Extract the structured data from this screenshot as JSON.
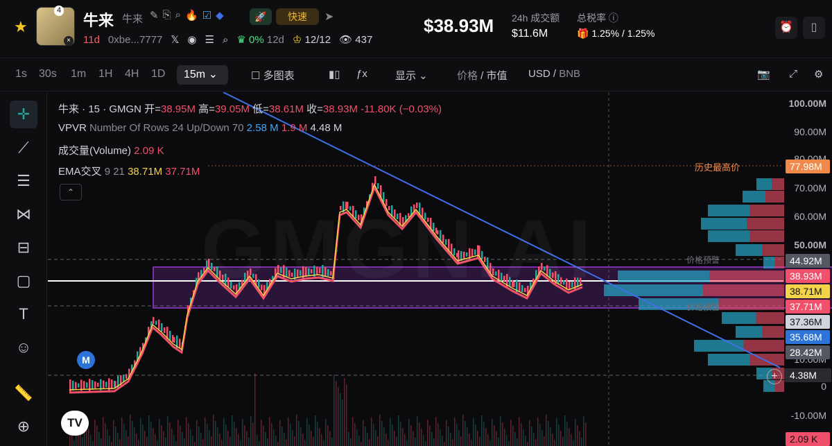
{
  "header": {
    "avatar_badge": "4",
    "name": "牛来",
    "symbol": "牛来",
    "fast_label": "快速",
    "age": "11d",
    "address": "0xbe...7777",
    "holder_pct": "0%",
    "holder_days": "12d",
    "crown_ratio": "12/12",
    "views": "437",
    "market_cap": "$38.93M",
    "volume_label": "24h 成交额",
    "volume_value": "$11.6M",
    "tax_label": "总税率",
    "tax_value": "1.25% / 1.25%"
  },
  "toolbar": {
    "timeframes": [
      "1s",
      "30s",
      "1m",
      "1H",
      "4H",
      "1D"
    ],
    "active_timeframe": "15m",
    "multi_chart": "多图表",
    "display": "显示",
    "price": "价格",
    "mcap": "市值",
    "currency": "USD",
    "currency_alt": "BNB"
  },
  "legend": {
    "title": "牛来 · 15 · GMGN",
    "open_label": "开=",
    "open": "38.95M",
    "high_label": "高=",
    "high": "39.05M",
    "low_label": "低=",
    "low": "38.61M",
    "close_label": "收=",
    "close": "38.93M",
    "change": "-11.80K (−0.03%)",
    "vpvr_label": "VPVR",
    "vpvr_params": "Number Of Rows 24 Up/Down 70",
    "vpvr_up": "2.58 M",
    "vpvr_down": "1.9 M",
    "vpvr_total": "4.48 M",
    "volume_label": "成交量(Volume)",
    "volume_value": "2.09 K",
    "ema_label": "EMA交叉",
    "ema_params": "9 21",
    "ema_fast": "38.71M",
    "ema_slow": "37.71M"
  },
  "watermark": "GMGN.AI",
  "annotations": {
    "ath": "历史最高价",
    "warn_top": "价格预警",
    "warn_bottom": "价格预警"
  },
  "y_axis": [
    "100.00M",
    "90.00M",
    "80.00M",
    "70.00M",
    "60.00M",
    "50.00M",
    "10.00M",
    "0",
    "-10.00M"
  ],
  "price_tags": [
    {
      "value": "77.98M",
      "color": "#f08a4a"
    },
    {
      "value": "44.92M",
      "color": "#555862"
    },
    {
      "value": "38.93M",
      "color": "#f0506a"
    },
    {
      "value": "38.71M",
      "color": "#f3d34a"
    },
    {
      "value": "37.71M",
      "color": "#f0506a"
    },
    {
      "value": "37.36M",
      "color": "#d1d4dc"
    },
    {
      "value": "35.68M",
      "color": "#2e74d8"
    },
    {
      "value": "28.42M",
      "color": "#555862"
    },
    {
      "value": "4.38M",
      "color": "#2a2a30"
    },
    {
      "value": "2.09 K",
      "color": "#f0506a"
    }
  ],
  "tools": [
    "crosshair-icon",
    "trendline-icon",
    "fib-icon",
    "pattern-icon",
    "projection-icon",
    "shapes-icon",
    "text-icon",
    "emoji-icon",
    "ruler-icon",
    "zoom-icon"
  ],
  "badges": {
    "m": "M",
    "tv": "TV"
  },
  "colors": {
    "up": "#26a69a",
    "down": "#f0506a",
    "ema_fast": "#f3d34a",
    "ema_slow": "#f0506a",
    "trendline": "#3f6fe8",
    "box": "#9b3bd8"
  }
}
